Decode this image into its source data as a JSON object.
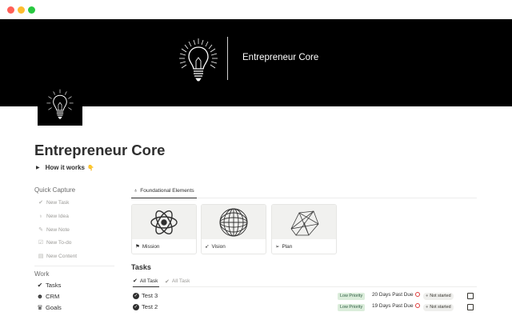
{
  "window": {
    "controls": [
      "close",
      "minimize",
      "zoom"
    ]
  },
  "cover": {
    "title": "Entrepreneur Core",
    "background": "#000000",
    "icon": "lightbulb-icon"
  },
  "page": {
    "title": "Entrepreneur Core",
    "toggle": {
      "label": "How it works",
      "emoji": "👇"
    }
  },
  "sidebar": {
    "quick_capture": {
      "heading": "Quick Capture",
      "items": [
        {
          "label": "New Task",
          "icon": "check-circle-icon"
        },
        {
          "label": "New Idea",
          "icon": "lightbulb-icon"
        },
        {
          "label": "New Note",
          "icon": "pencil-icon"
        },
        {
          "label": "New To-do",
          "icon": "checkbox-icon"
        },
        {
          "label": "New Content",
          "icon": "document-icon"
        }
      ]
    },
    "work": {
      "heading": "Work",
      "items": [
        {
          "label": "Tasks",
          "icon": "check-circle-icon"
        },
        {
          "label": "CRM",
          "icon": "people-icon"
        },
        {
          "label": "Goals",
          "icon": "trophy-icon"
        }
      ]
    }
  },
  "foundational": {
    "tab_label": "Foundational Elements",
    "tab_icon": "lightbulb-icon",
    "cards": [
      {
        "label": "Mission",
        "icon": "flag-icon"
      },
      {
        "label": "Vision",
        "icon": "runner-icon"
      },
      {
        "label": "Plan",
        "icon": "paper-plane-icon"
      }
    ]
  },
  "tasks": {
    "heading": "Tasks",
    "views": [
      {
        "label": "All Task",
        "icon": "check-circle-icon",
        "active": true
      },
      {
        "label": "All Task",
        "icon": "check-circle-icon",
        "active": false
      }
    ],
    "rows": [
      {
        "name": "Test 3",
        "priority": "Low Priority",
        "due": "20 Days Past Due",
        "status": "Not started",
        "done": false
      },
      {
        "name": "Test 2",
        "priority": "Low Priority",
        "due": "19 Days Past Due",
        "status": "Not started",
        "done": false
      }
    ]
  },
  "colors": {
    "text": "#37352f",
    "muted": "#9b9a97",
    "priority_bg": "#dbeddb",
    "priority_text": "#2b593f",
    "status_bg": "#efefed",
    "overdue": "#e03e3e"
  }
}
